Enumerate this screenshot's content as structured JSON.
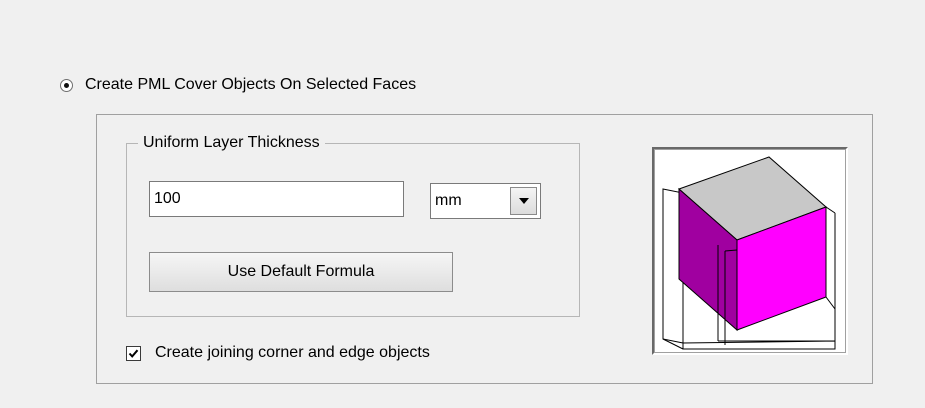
{
  "pml_option": {
    "label": "Create PML Cover Objects On Selected Faces",
    "selected": true
  },
  "thickness_group": {
    "title": "Uniform Layer Thickness",
    "value": "100",
    "unit": "mm",
    "default_formula_label": "Use Default Formula"
  },
  "joining_option": {
    "label": "Create joining corner and edge objects",
    "checked": true
  },
  "preview": {
    "top_face_color": "#c8c8c8",
    "side_face_color": "#ff00ff",
    "dark_face_color": "#a000a0",
    "outline_color": "#000000"
  }
}
